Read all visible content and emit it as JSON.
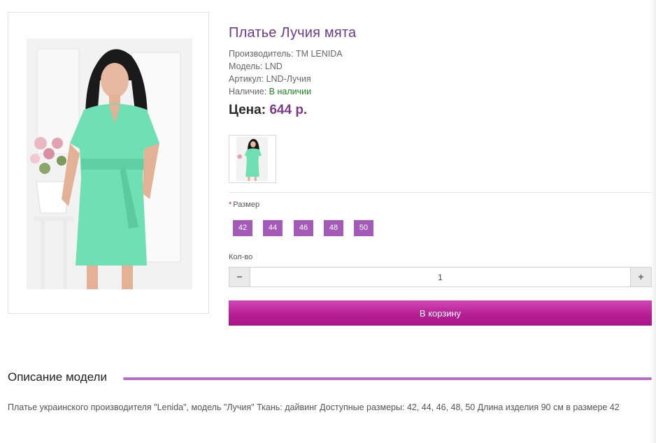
{
  "product": {
    "title": "Платье Лучия мята",
    "manufacturer_label": "Производитель:",
    "manufacturer": "TM LENIDA",
    "model_label": "Модель:",
    "model": "LND",
    "sku_label": "Артикул:",
    "sku": "LND-Лучия",
    "availability_label": "Наличие:",
    "availability": "В наличии",
    "price_label": "Цена:",
    "price": "644 р."
  },
  "options": {
    "required_mark": "*",
    "size_label": "Размер",
    "sizes": [
      "42",
      "44",
      "46",
      "48",
      "50"
    ],
    "qty_label": "Кол-во",
    "qty_value": "1",
    "minus": "−",
    "plus": "+"
  },
  "cart_button": "В корзину",
  "description": {
    "title": "Описание модели",
    "text": "Платье украинского производителя \"Lenida\", модель \"Лучия\" Ткань: дайвинг Доступные размеры: 42, 44, 46, 48, 50 Длина изделия 90 см в размере 42"
  },
  "colors": {
    "title": "#6b3b8a",
    "price": "#7d3a88",
    "size_chip": "#a45bb8",
    "cart": "#b61f96",
    "availability": "#1c8c1c"
  }
}
